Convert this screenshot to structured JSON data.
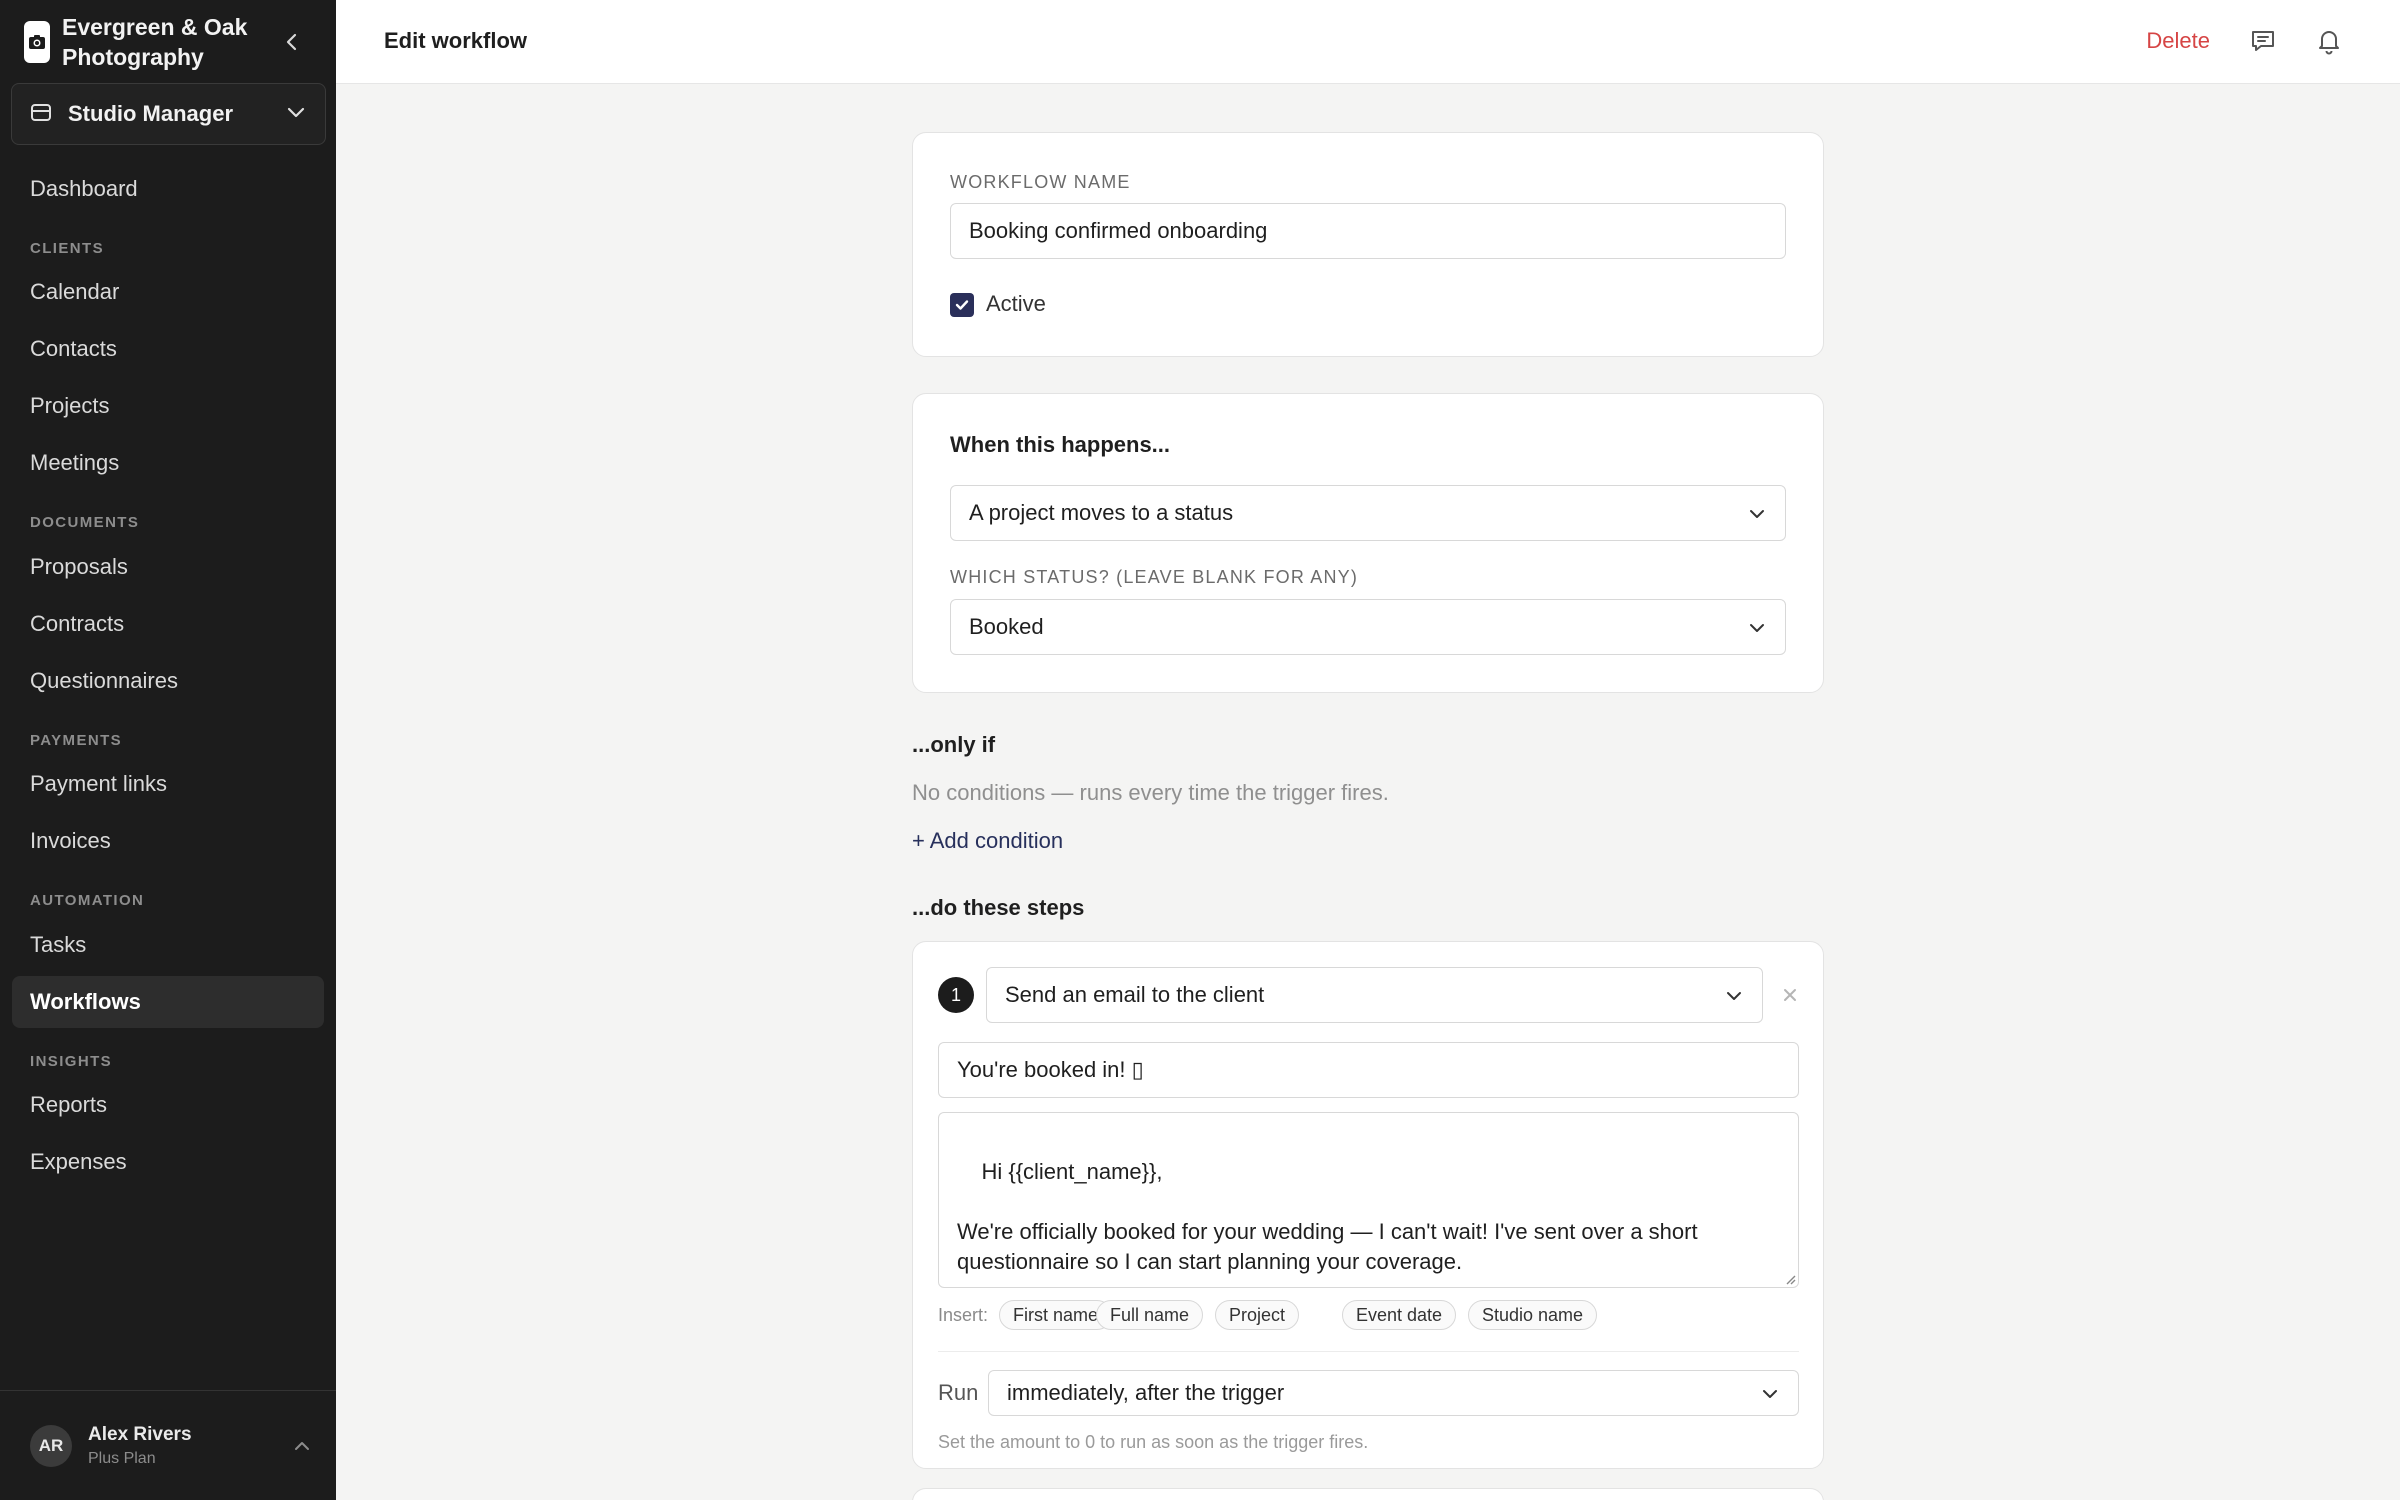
{
  "brand": {
    "name": "Evergreen & Oak Photography"
  },
  "workspace": {
    "label": "Studio Manager"
  },
  "nav": {
    "dashboard": "Dashboard",
    "sections": {
      "clients": "CLIENTS",
      "documents": "DOCUMENTS",
      "payments": "PAYMENTS",
      "automation": "AUTOMATION",
      "insights": "INSIGHTS"
    },
    "items": {
      "calendar": "Calendar",
      "contacts": "Contacts",
      "projects": "Projects",
      "meetings": "Meetings",
      "proposals": "Proposals",
      "contracts": "Contracts",
      "questionnaires": "Questionnaires",
      "payment_links": "Payment links",
      "invoices": "Invoices",
      "tasks": "Tasks",
      "workflows": "Workflows",
      "reports": "Reports",
      "expenses": "Expenses"
    },
    "active": "workflows"
  },
  "user": {
    "initials": "AR",
    "name": "Alex Rivers",
    "plan": "Plus Plan"
  },
  "header": {
    "title": "Edit workflow",
    "delete_label": "Delete"
  },
  "workflow": {
    "name_label": "WORKFLOW NAME",
    "name_value": "Booking confirmed onboarding",
    "active_label": "Active",
    "active_checked": true
  },
  "trigger": {
    "heading": "When this happens...",
    "event_value": "A project moves to a status",
    "status_label": "WHICH STATUS? (LEAVE BLANK FOR ANY)",
    "status_value": "Booked"
  },
  "conditions": {
    "heading": "...only if",
    "empty_text": "No conditions — runs every time the trigger fires.",
    "add_label": "+ Add condition"
  },
  "steps": {
    "heading": "...do these steps",
    "items": [
      {
        "number": "1",
        "action": "Send an email to the client",
        "subject": "You're booked in! ▯",
        "body": "Hi {{client_name}},\n\nWe're officially booked for your wedding — I can't wait! I've sent over a short\nquestionnaire so I can start planning your coverage.\n\nAlex",
        "insert_label": "Insert:",
        "insert_tokens": [
          "First name",
          "Full name",
          "Project",
          "Event date",
          "Studio name"
        ],
        "run_label": "Run",
        "run_value": "immediately, after the trigger",
        "run_hint": "Set the amount to 0 to run as soon as the trigger fires."
      }
    ]
  },
  "colors": {
    "sidebar_bg": "#1c1c1c",
    "accent": "#27305c",
    "danger": "#d64545"
  }
}
